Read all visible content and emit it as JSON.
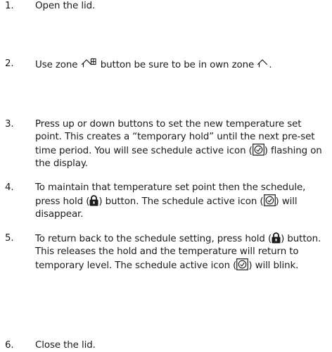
{
  "steps": [
    {
      "number": "1.",
      "text": "Open the lid."
    },
    {
      "number": "2.",
      "part1": "Use zone",
      "part2": "button be sure to be in own zone",
      "part3": ".",
      "icons": [
        "zone-icon",
        "house-zone-icon"
      ]
    },
    {
      "number": "3.",
      "part1": "Press up or down buttons to set the new temperature set point. This creates a “temporary hold” until the next pre-set time period. You will see schedule active icon (",
      "part2": ") flashing on the display.",
      "icons": [
        "schedule-active-icon"
      ]
    },
    {
      "number": "4.",
      "part1": "To maintain that temperature set point then the schedule, press hold (",
      "part2": ") button. The schedule active icon (",
      "part3": ") will disappear.",
      "icons": [
        "lock-icon",
        "schedule-active-icon"
      ]
    },
    {
      "number": "5.",
      "part1": "To return back to the schedule setting, press hold (",
      "part2": ") button. This releases the hold and the temperature will return to temporary level. The schedule active icon (",
      "part3": ") will blink.",
      "icons": [
        "lock-icon",
        "schedule-active-icon"
      ]
    },
    {
      "number": "6.",
      "text": "Close the lid."
    }
  ],
  "colors": {
    "text": "#1a1a1a",
    "background": "#ffffff"
  }
}
